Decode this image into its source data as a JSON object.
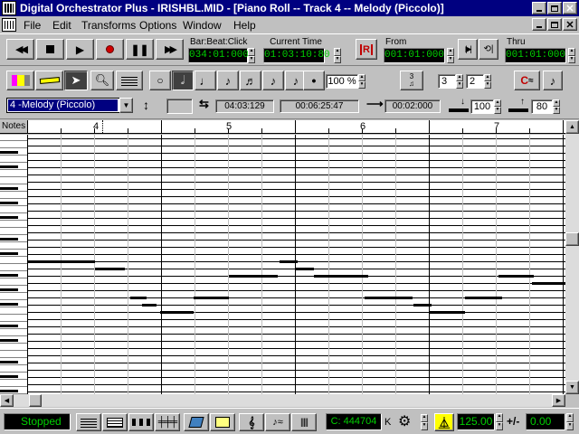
{
  "window": {
    "title": "Digital Orchestrator Plus - IRISHBL.MID - [Piano Roll -- Track 4 -- Melody  (Piccolo)]"
  },
  "menu": {
    "items": [
      "File",
      "Edit",
      "Transforms",
      "Options",
      "Window",
      "Help"
    ]
  },
  "transport": {
    "bar_beat_click_label": "Bar:Beat:Click",
    "bar_beat_click_value": "034:01:000",
    "current_time_label": "Current Time",
    "current_time_value": "01:03:10:80",
    "record_mark": "R",
    "from_label": "From",
    "from_value": "001:01:000",
    "thru_label": "Thru",
    "thru_value": "001:01:000"
  },
  "toolbar": {
    "zoom_value": "100",
    "zoom_unit": "%",
    "tuplet_top": "3",
    "tuplet_bottom": "2",
    "time_sig_num": "3",
    "time_sig_den": "2",
    "c_button_label": "C"
  },
  "edit": {
    "track_select": "4 -Melody  (Piccolo)",
    "pitch_value": "",
    "start_value": "04:03:129",
    "duration_value": "00:06:25:47",
    "length_value": "00:02:000",
    "velocity_down": "100",
    "velocity_up": "80"
  },
  "roll": {
    "notes_label": "Notes",
    "measures": [
      "4",
      "5",
      "6",
      "7"
    ]
  },
  "status": {
    "state": "Stopped",
    "counter": "C: 444704",
    "counter_unit": "K",
    "tempo": "125.00",
    "offset": "0.00",
    "plusminus": "+/-"
  }
}
